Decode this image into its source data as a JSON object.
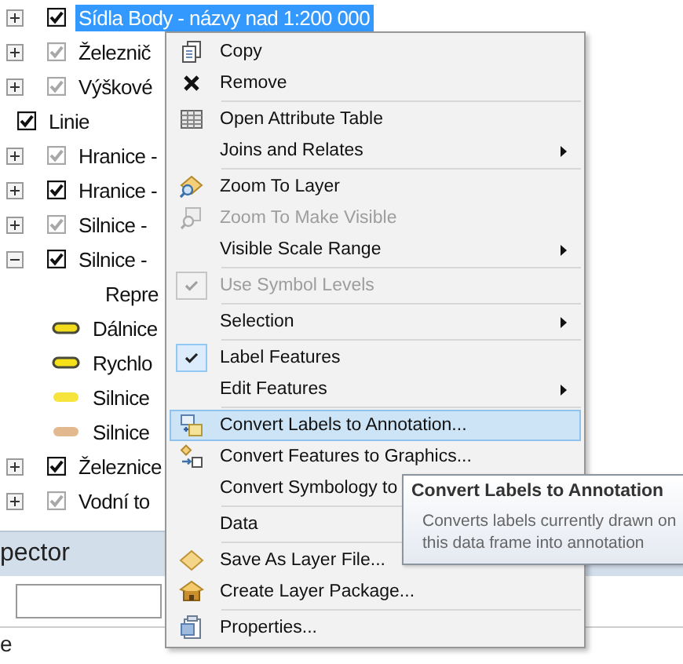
{
  "tree": [
    {
      "kind": "layer",
      "label": "Sídla Body - názvy nad 1:200 000",
      "checked": true,
      "dimmed": false,
      "expanded": false,
      "selected": true
    },
    {
      "kind": "layer",
      "label": "Železnič",
      "checked": true,
      "dimmed": true,
      "expanded": false,
      "selected": false
    },
    {
      "kind": "layer",
      "label": "Výškové",
      "checked": true,
      "dimmed": true,
      "expanded": false,
      "selected": false
    },
    {
      "kind": "group",
      "label": "Linie",
      "checked": true,
      "dimmed": false,
      "selected": false
    },
    {
      "kind": "layer",
      "label": "Hranice -",
      "checked": true,
      "dimmed": true,
      "expanded": false,
      "selected": false
    },
    {
      "kind": "layer",
      "label": "Hranice -",
      "checked": true,
      "dimmed": false,
      "expanded": false,
      "selected": false
    },
    {
      "kind": "layer",
      "label": "Silnice -",
      "checked": true,
      "dimmed": true,
      "expanded": false,
      "selected": false
    },
    {
      "kind": "layer",
      "label": "Silnice -",
      "checked": true,
      "dimmed": false,
      "expanded": true,
      "selected": false,
      "children": [
        {
          "kind": "heading",
          "label": "Repre"
        },
        {
          "kind": "symbol",
          "label": "Dálnice",
          "color": "#f2dc1c",
          "outlined": true
        },
        {
          "kind": "symbol",
          "label": "Rychlo",
          "color": "#f7e21a",
          "outlined": true
        },
        {
          "kind": "symbol",
          "label": "Silnice",
          "color": "#f6e43c",
          "outlined": false
        },
        {
          "kind": "symbol",
          "label": "Silnice",
          "color": "#e2b98e",
          "outlined": false
        }
      ]
    },
    {
      "kind": "layer",
      "label": "Železnice",
      "checked": true,
      "dimmed": false,
      "expanded": false,
      "selected": false
    },
    {
      "kind": "layer",
      "label": "Vodní to",
      "checked": true,
      "dimmed": true,
      "expanded": false,
      "selected": false
    }
  ],
  "inspector": {
    "title": "pector",
    "footer": "e"
  },
  "context_menu": [
    {
      "kind": "item",
      "label": "Copy",
      "disabled": false,
      "checked": false,
      "submenu": false,
      "selected": false
    },
    {
      "kind": "item",
      "label": "Remove",
      "disabled": false,
      "checked": false,
      "submenu": false,
      "selected": false
    },
    {
      "kind": "separator"
    },
    {
      "kind": "item",
      "label": "Open Attribute Table",
      "disabled": false,
      "checked": false,
      "submenu": false,
      "selected": false
    },
    {
      "kind": "item",
      "label": "Joins and Relates",
      "disabled": false,
      "checked": false,
      "submenu": true,
      "selected": false
    },
    {
      "kind": "separator"
    },
    {
      "kind": "item",
      "label": "Zoom To Layer",
      "disabled": false,
      "checked": false,
      "submenu": false,
      "selected": false
    },
    {
      "kind": "item",
      "label": "Zoom To Make Visible",
      "disabled": true,
      "checked": false,
      "submenu": false,
      "selected": false
    },
    {
      "kind": "item",
      "label": "Visible Scale Range",
      "disabled": false,
      "checked": false,
      "submenu": true,
      "selected": false
    },
    {
      "kind": "separator"
    },
    {
      "kind": "item",
      "label": "Use Symbol Levels",
      "disabled": true,
      "checked": true,
      "submenu": false,
      "selected": false
    },
    {
      "kind": "separator"
    },
    {
      "kind": "item",
      "label": "Selection",
      "disabled": false,
      "checked": false,
      "submenu": true,
      "selected": false
    },
    {
      "kind": "separator"
    },
    {
      "kind": "item",
      "label": "Label Features",
      "disabled": false,
      "checked": true,
      "submenu": false,
      "selected": false
    },
    {
      "kind": "item",
      "label": "Edit Features",
      "disabled": false,
      "checked": false,
      "submenu": true,
      "selected": false
    },
    {
      "kind": "separator"
    },
    {
      "kind": "item",
      "label": "Convert Labels to Annotation...",
      "disabled": false,
      "checked": false,
      "submenu": false,
      "selected": true
    },
    {
      "kind": "item",
      "label": "Convert Features to Graphics...",
      "disabled": false,
      "checked": false,
      "submenu": false,
      "selected": false
    },
    {
      "kind": "item",
      "label": "Convert Symbology to",
      "disabled": false,
      "checked": false,
      "submenu": false,
      "selected": false
    },
    {
      "kind": "separator"
    },
    {
      "kind": "item",
      "label": "Data",
      "disabled": false,
      "checked": false,
      "submenu": false,
      "selected": false
    },
    {
      "kind": "separator"
    },
    {
      "kind": "item",
      "label": "Save As Layer File...",
      "disabled": false,
      "checked": false,
      "submenu": false,
      "selected": false
    },
    {
      "kind": "item",
      "label": "Create Layer Package...",
      "disabled": false,
      "checked": false,
      "submenu": false,
      "selected": false
    },
    {
      "kind": "separator"
    },
    {
      "kind": "item",
      "label": "Properties...",
      "disabled": false,
      "checked": false,
      "submenu": false,
      "selected": false
    }
  ],
  "tooltip": {
    "title": "Convert Labels to Annotation",
    "text": "Converts labels currently drawn on this data frame into annotation"
  }
}
